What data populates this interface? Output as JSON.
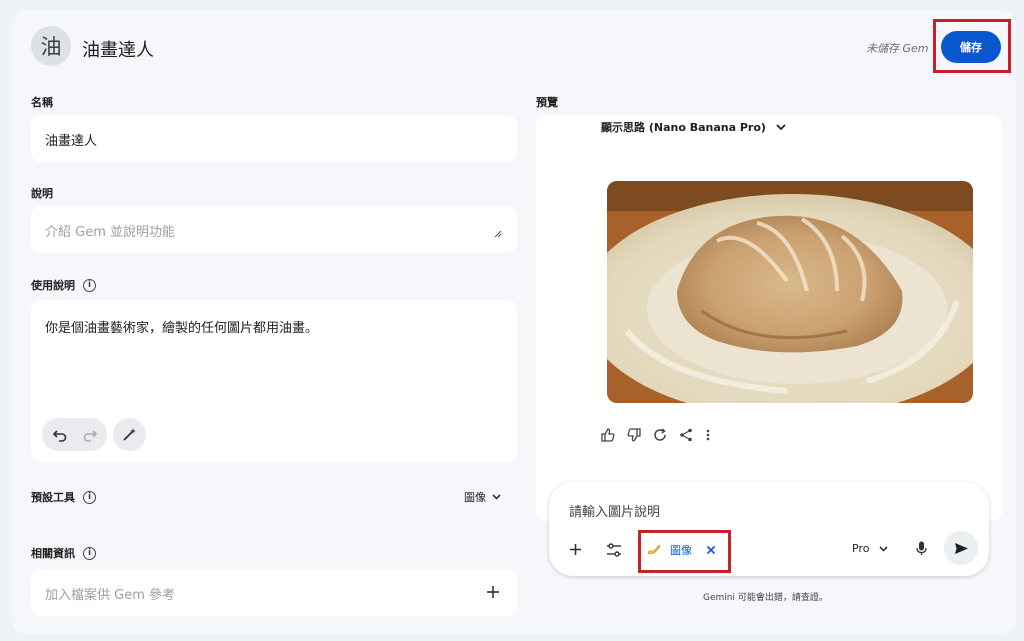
{
  "header": {
    "avatar_char": "油",
    "title": "油畫達人",
    "unsaved": "未儲存 Gem",
    "save_label": "儲存"
  },
  "form": {
    "name_label": "名稱",
    "name_value": "油畫達人",
    "desc_label": "說明",
    "desc_placeholder": "介紹 Gem 並說明功能",
    "instr_label": "使用說明",
    "instr_value": "你是個油畫藝術家，繪製的任何圖片都用油畫。",
    "tools_label": "預設工具",
    "tools_value": "圖像",
    "knowledge_label": "相關資訊",
    "knowledge_placeholder": "加入檔案供 Gem 參考"
  },
  "preview": {
    "label": "預覽",
    "thinking_label": "顯示思路 (Nano Banana Pro)",
    "input_placeholder": "請輸入圖片說明",
    "chip_label": "圖像",
    "model_label": "Pro",
    "disclaimer": "Gemini 可能會出錯，請查證。"
  },
  "icons": {
    "undo": "undo-icon",
    "redo": "redo-icon",
    "magic": "magic-wand-icon",
    "info": "info-icon",
    "chevron": "chevron-down-icon",
    "plus": "plus-icon",
    "tools": "tools-icon",
    "mic": "mic-icon",
    "send": "send-icon",
    "thumbs_up": "thumbs-up-icon",
    "thumbs_down": "thumbs-down-icon",
    "refresh": "refresh-icon",
    "share": "share-icon",
    "more": "more-vert-icon",
    "banana": "banana-icon",
    "close": "close-icon"
  },
  "colors": {
    "accent": "#0b57d0",
    "highlight": "#c8202a",
    "background": "#f5f7fb"
  }
}
